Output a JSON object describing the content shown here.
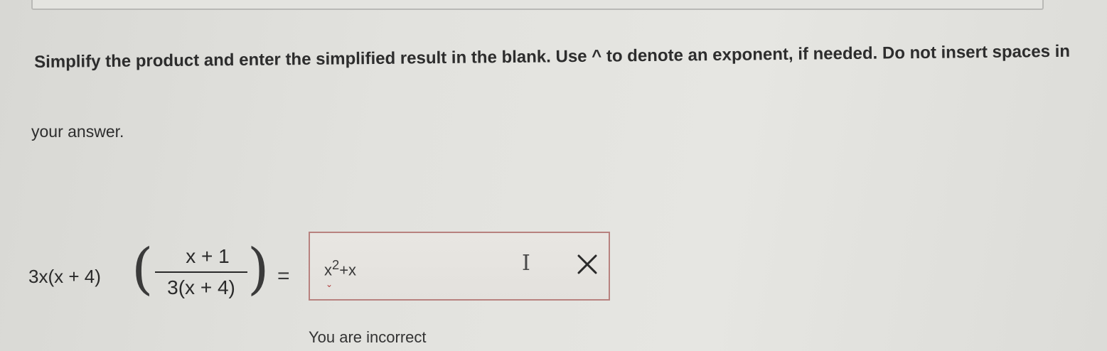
{
  "instructions": {
    "line1": "Simplify the product and enter the simplified result in the blank. Use ^ to denote an exponent, if needed. Do not insert spaces in",
    "line2": "your answer."
  },
  "equation": {
    "lhs": "3x(x + 4)",
    "left_paren": "(",
    "numerator": "x + 1",
    "denominator": "3(x + 4)",
    "right_paren": ")",
    "equals": "="
  },
  "answer": {
    "value": "x^2+x",
    "base": "x",
    "exponent": "2",
    "rest": "+x"
  },
  "icons": {
    "caret": "caret-down-icon",
    "cursor": "text-cursor-icon",
    "close": "close-icon",
    "cursor_glyph": "I",
    "caret_glyph": "⌄"
  },
  "feedback": {
    "text": "You are incorrect"
  },
  "colors": {
    "answer_border": "#b8827f",
    "error_icon": "#2a2a2a"
  }
}
